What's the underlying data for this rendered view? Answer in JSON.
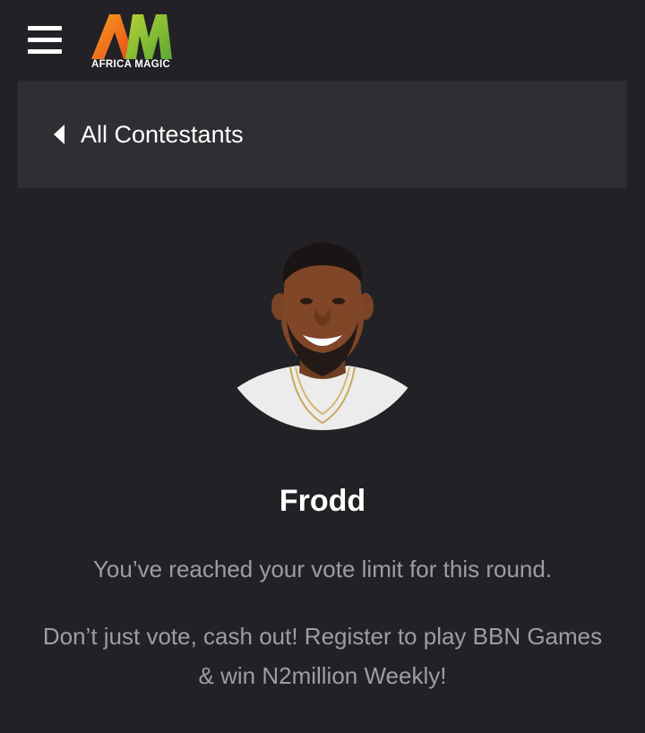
{
  "header": {
    "logo_text": "AFRICA MAGIC",
    "menu_icon": "hamburger-icon",
    "colors": {
      "background": "#222226",
      "logo_orange": "#f26a21",
      "logo_green": "#8dc63f"
    }
  },
  "nav": {
    "back_label": "All Contestants",
    "back_icon": "caret-left-icon",
    "bar_color": "#2e2e33"
  },
  "contestant": {
    "name": "Frodd",
    "vote_limit_message": "You’ve reached your vote limit for this round.",
    "promo_message": "Don’t just vote, cash out! Register to play BBN Games & win N2million Weekly!"
  }
}
